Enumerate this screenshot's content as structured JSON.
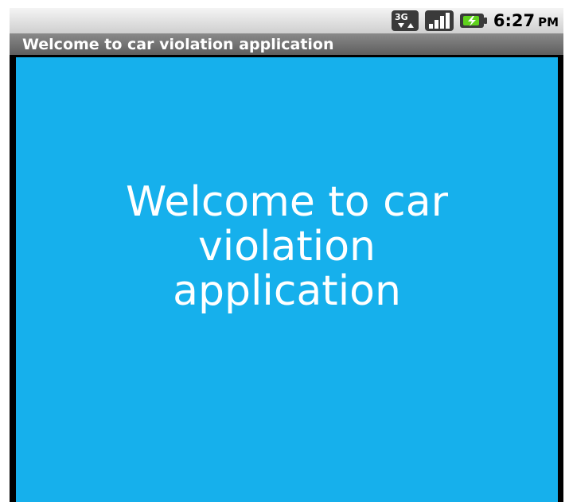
{
  "status_bar": {
    "network_icon": "3g-data-icon",
    "signal_icon": "signal-strength-icon",
    "battery_icon": "battery-charging-icon",
    "time": "6:27",
    "ampm": "PM"
  },
  "title_bar": {
    "title": "Welcome to car violation application"
  },
  "main": {
    "welcome_lines": [
      "Welcome to car",
      "violation",
      "application"
    ]
  },
  "colors": {
    "background": "#16b0ec",
    "status_bar": "#e0e0e0",
    "title_bar": "#6f6f6f"
  }
}
